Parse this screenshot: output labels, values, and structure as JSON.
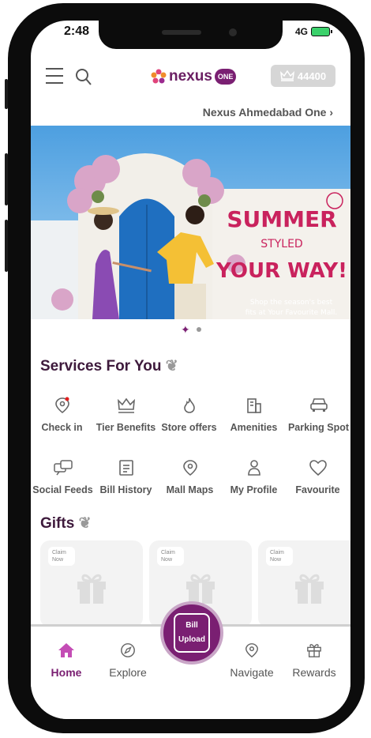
{
  "status": {
    "time": "2:48",
    "network": "4G"
  },
  "header": {
    "logo_text": "nexus",
    "logo_badge": "ONE",
    "points": "44400"
  },
  "mall": {
    "name": "Nexus Ahmedabad One"
  },
  "banner": {
    "line1": "SUMMER",
    "line2": "STYLED",
    "line3": "YOUR WAY!",
    "caption1": "Shop the season's best",
    "caption2": "fits at Your Favourite Mall."
  },
  "services": {
    "title": "Services For You",
    "items": [
      {
        "label": "Check in",
        "icon": "location-pin-icon"
      },
      {
        "label": "Tier Benefits",
        "icon": "crown-icon"
      },
      {
        "label": "Store offers",
        "icon": "flame-icon"
      },
      {
        "label": "Amenities",
        "icon": "building-icon"
      },
      {
        "label": "Parking Spot",
        "icon": "car-icon"
      },
      {
        "label": "Social Feeds",
        "icon": "chat-icon"
      },
      {
        "label": "Bill History",
        "icon": "document-icon"
      },
      {
        "label": "Mall Maps",
        "icon": "map-pin-icon"
      },
      {
        "label": "My Profile",
        "icon": "person-icon"
      },
      {
        "label": "Favourite",
        "icon": "heart-icon"
      }
    ]
  },
  "gifts": {
    "title": "Gifts",
    "cards": [
      {
        "tag": "Claim Now"
      },
      {
        "tag": "Claim Now"
      },
      {
        "tag": "Claim Now"
      }
    ]
  },
  "upload": {
    "line1": "Bill",
    "line2": "Upload"
  },
  "tabbar": {
    "home": "Home",
    "explore": "Explore",
    "navigate": "Navigate",
    "rewards": "Rewards"
  },
  "colors": {
    "brand": "#7a1f72",
    "active_tab": "#7a1f72"
  }
}
